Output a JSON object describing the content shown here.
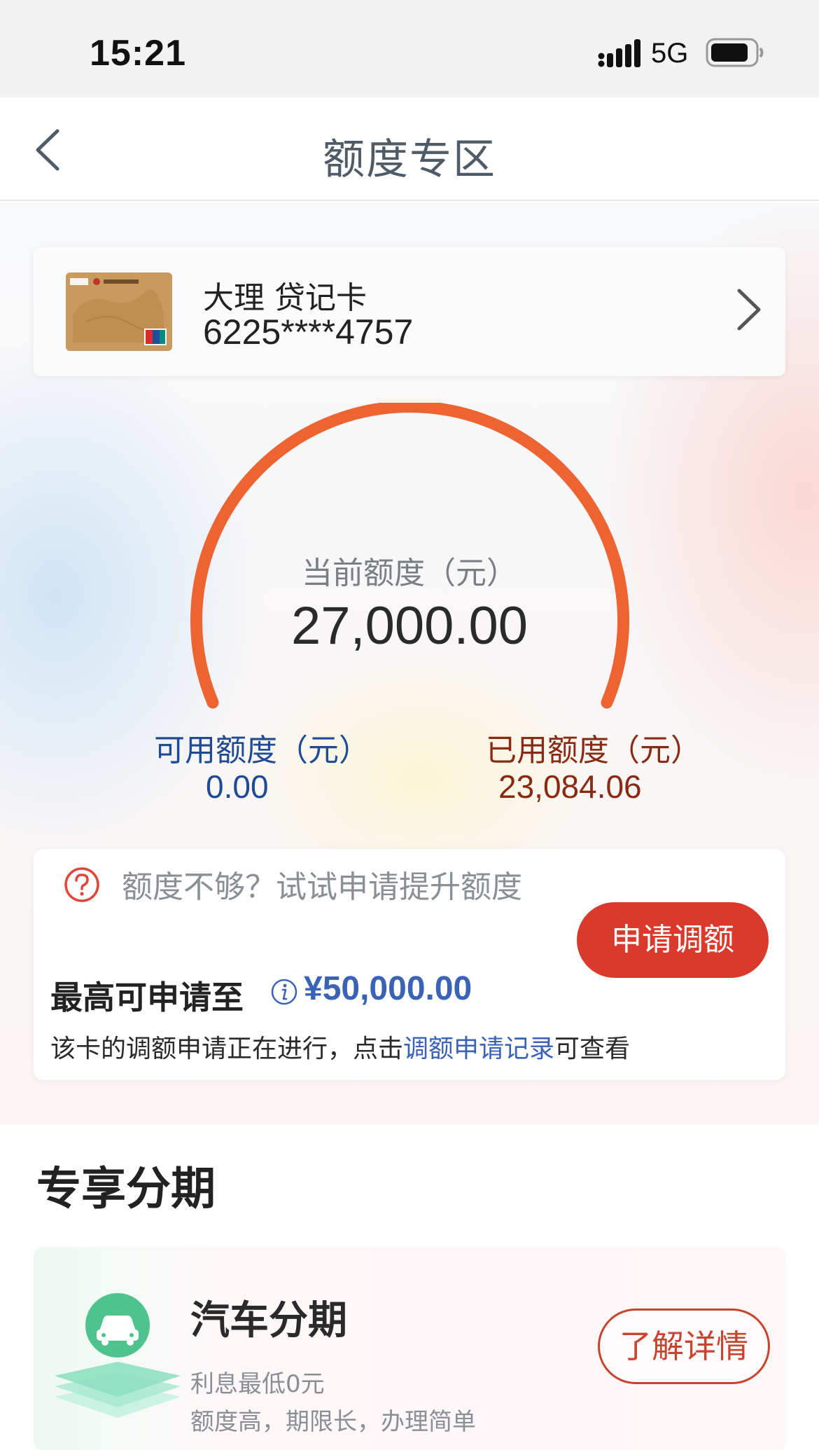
{
  "status_bar": {
    "time": "15:21",
    "network": "5G",
    "icons": [
      "signal-icon",
      "battery-icon"
    ]
  },
  "nav": {
    "title": "额度专区",
    "back_icon": "chevron-left-icon"
  },
  "card": {
    "name": "大理 贷记卡",
    "number": "6225****4757",
    "arrow_icon": "chevron-right-icon"
  },
  "gauge": {
    "label": "当前额度（元）",
    "value": "27,000.00",
    "color": "#ee6332"
  },
  "balances": {
    "available_label": "可用额度（元）",
    "available_value": "0.00",
    "used_label": "已用额度（元）",
    "used_value": "23,084.06"
  },
  "limit_panel": {
    "prompt": "额度不够？试试申请提升额度",
    "apply_button": "申请调额",
    "max_label": "最高可申请至",
    "max_value": "¥50,000.00",
    "status_prefix": "该卡的调额申请正在进行，点击",
    "status_link": "调额申请记录",
    "status_suffix": "可查看"
  },
  "installments": {
    "section_title": "专享分期",
    "items": [
      {
        "title": "汽车分期",
        "line1": "利息最低0元",
        "line2": "额度高，期限长，办理简单",
        "button": "了解详情",
        "icon": "car-icon"
      }
    ]
  },
  "colors": {
    "accent_red": "#d93a2b",
    "link_blue": "#3a62b7",
    "available_blue": "#1f4a94",
    "used_brown": "#8a2a12"
  }
}
